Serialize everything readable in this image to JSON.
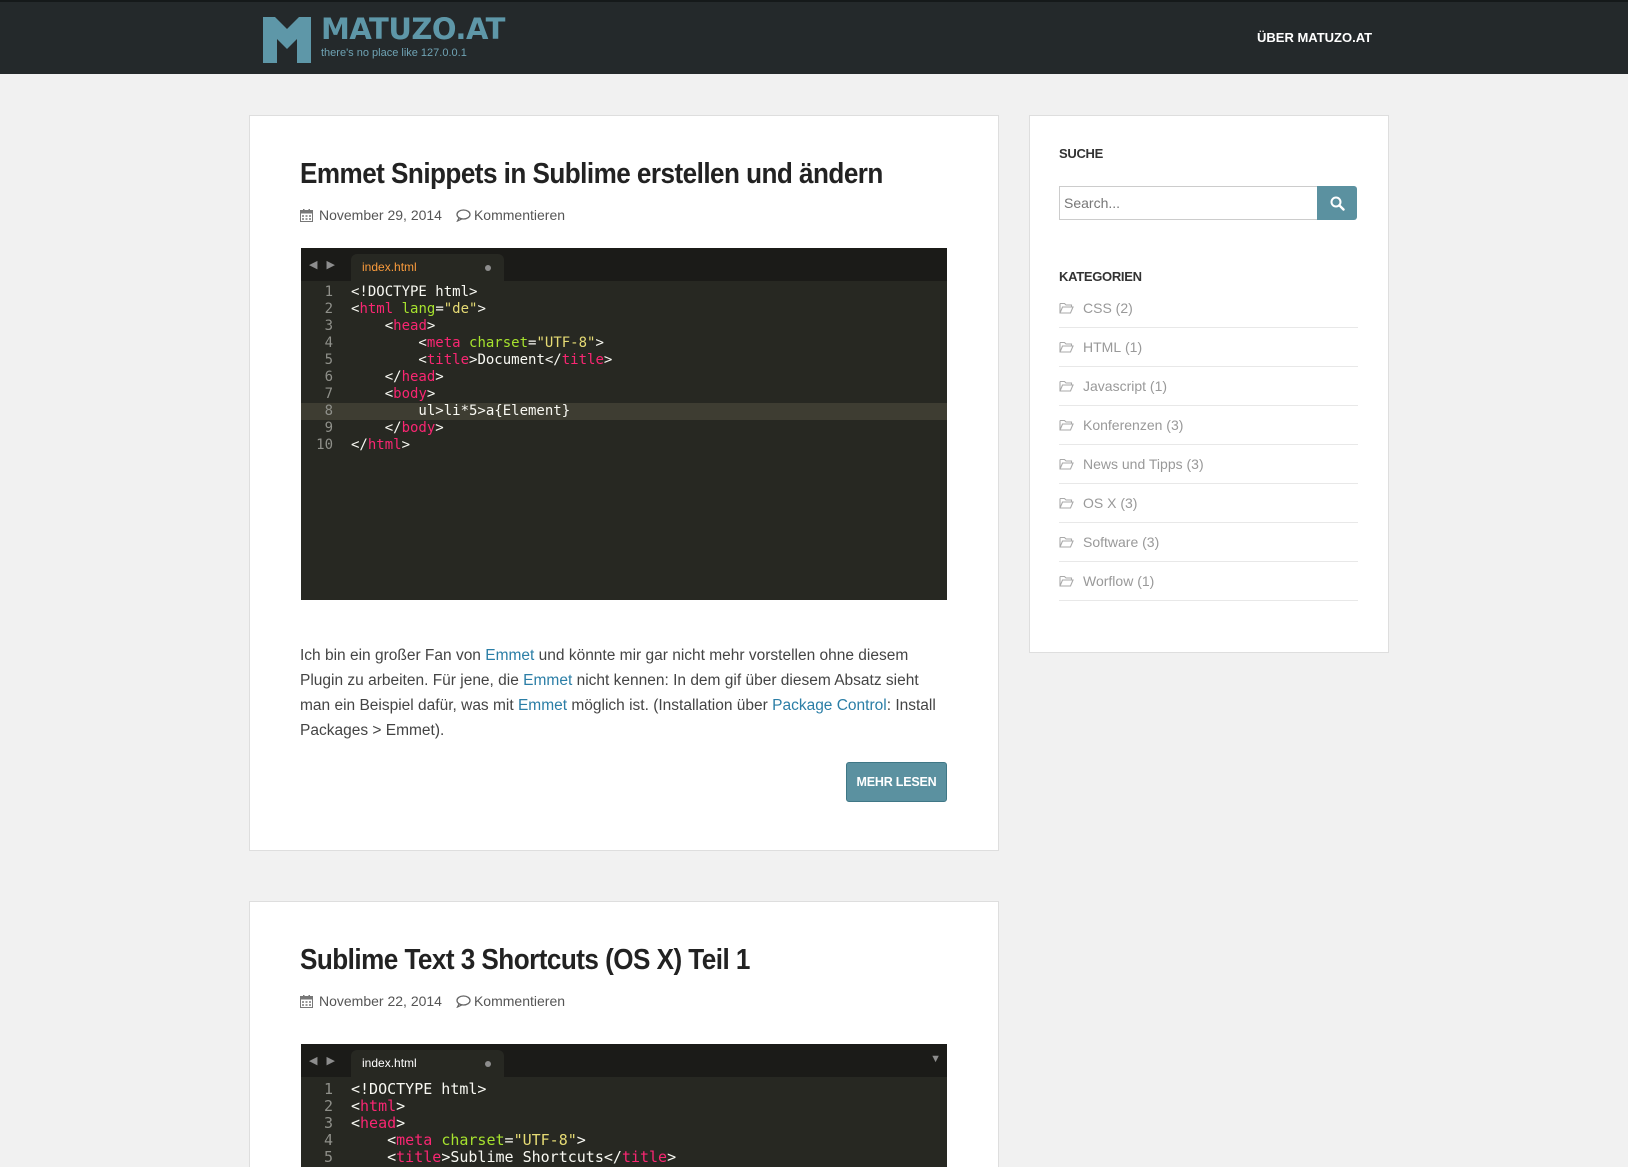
{
  "header": {
    "site_title": "MATUZO.AT",
    "tagline": "there's no place like 127.0.0.1",
    "nav": [
      "ÜBER MATUZO.AT"
    ],
    "brand_color": "#5e97a8"
  },
  "posts": [
    {
      "title": "Emmet Snippets in Sublime erstellen und ändern",
      "date": "November 29, 2014",
      "comments_label": "Kommentieren",
      "editor": {
        "tab_name": "index.html",
        "tab_color": "#f99b3c",
        "lines": [
          [
            {
              "t": "<!DOCTYPE html>",
              "c": ""
            }
          ],
          [
            {
              "t": "<",
              "c": ""
            },
            {
              "t": "html",
              "c": "t-tag"
            },
            {
              "t": " ",
              "c": ""
            },
            {
              "t": "lang",
              "c": "t-attr"
            },
            {
              "t": "=",
              "c": ""
            },
            {
              "t": "\"de\"",
              "c": "t-str"
            },
            {
              "t": ">",
              "c": ""
            }
          ],
          [
            {
              "t": "    <",
              "c": ""
            },
            {
              "t": "head",
              "c": "t-tag"
            },
            {
              "t": ">",
              "c": ""
            }
          ],
          [
            {
              "t": "        <",
              "c": ""
            },
            {
              "t": "meta",
              "c": "t-tag"
            },
            {
              "t": " ",
              "c": ""
            },
            {
              "t": "charset",
              "c": "t-attr"
            },
            {
              "t": "=",
              "c": ""
            },
            {
              "t": "\"UTF-8\"",
              "c": "t-str"
            },
            {
              "t": ">",
              "c": ""
            }
          ],
          [
            {
              "t": "        <",
              "c": ""
            },
            {
              "t": "title",
              "c": "t-tag"
            },
            {
              "t": ">Document</",
              "c": ""
            },
            {
              "t": "title",
              "c": "t-tag"
            },
            {
              "t": ">",
              "c": ""
            }
          ],
          [
            {
              "t": "    </",
              "c": ""
            },
            {
              "t": "head",
              "c": "t-tag"
            },
            {
              "t": ">",
              "c": ""
            }
          ],
          [
            {
              "t": "    <",
              "c": ""
            },
            {
              "t": "body",
              "c": "t-tag"
            },
            {
              "t": ">",
              "c": ""
            }
          ],
          [
            {
              "t": "        ul>li*5>a{Element}",
              "c": ""
            }
          ],
          [
            {
              "t": "    </",
              "c": ""
            },
            {
              "t": "body",
              "c": "t-tag"
            },
            {
              "t": ">",
              "c": ""
            }
          ],
          [
            {
              "t": "</",
              "c": ""
            },
            {
              "t": "html",
              "c": "t-tag"
            },
            {
              "t": ">",
              "c": ""
            }
          ]
        ],
        "active_line": 8
      },
      "excerpt": [
        {
          "t": "Ich bin ein großer Fan von ",
          "link": false
        },
        {
          "t": "Emmet",
          "link": true
        },
        {
          "t": " und könnte mir gar nicht mehr vorstellen ohne diesem Plugin zu arbeiten. Für jene, die ",
          "link": false
        },
        {
          "t": "Emmet",
          "link": true
        },
        {
          "t": " nicht kennen: In dem gif über diesem Absatz sieht man ein Beispiel dafür, was mit ",
          "link": false
        },
        {
          "t": "Emmet",
          "link": true
        },
        {
          "t": " möglich ist. (Installation über ",
          "link": false
        },
        {
          "t": "Package Control",
          "link": true
        },
        {
          "t": ": Install Packages > Emmet).",
          "link": false
        }
      ],
      "read_more": "MEHR LESEN"
    },
    {
      "title": "Sublime Text 3 Shortcuts (OS X) Teil 1",
      "date": "November 22, 2014",
      "comments_label": "Kommentieren",
      "editor": {
        "tab_name": "index.html",
        "tab_color": "#ffffff",
        "lines": [
          [
            {
              "t": "<!DOCTYPE html>",
              "c": ""
            }
          ],
          [
            {
              "t": "<",
              "c": ""
            },
            {
              "t": "html",
              "c": "t-tag"
            },
            {
              "t": ">",
              "c": ""
            }
          ],
          [
            {
              "t": "<",
              "c": ""
            },
            {
              "t": "head",
              "c": "t-tag"
            },
            {
              "t": ">",
              "c": ""
            }
          ],
          [
            {
              "t": "    <",
              "c": ""
            },
            {
              "t": "meta",
              "c": "t-tag"
            },
            {
              "t": " ",
              "c": ""
            },
            {
              "t": "charset",
              "c": "t-attr"
            },
            {
              "t": "=",
              "c": ""
            },
            {
              "t": "\"UTF-8\"",
              "c": "t-str"
            },
            {
              "t": ">",
              "c": ""
            }
          ],
          [
            {
              "t": "    <",
              "c": ""
            },
            {
              "t": "title",
              "c": "t-tag"
            },
            {
              "t": ">Sublime Shortcuts</",
              "c": ""
            },
            {
              "t": "title",
              "c": "t-tag"
            },
            {
              "t": ">",
              "c": ""
            }
          ]
        ],
        "active_line": 0
      }
    }
  ],
  "sidebar": {
    "search_title": "SUCHE",
    "search_placeholder": "Search...",
    "categories_title": "KATEGORIEN",
    "categories": [
      {
        "name": "CSS",
        "count": "(2)"
      },
      {
        "name": "HTML",
        "count": "(1)"
      },
      {
        "name": "Javascript",
        "count": "(1)"
      },
      {
        "name": "Konferenzen",
        "count": "(3)"
      },
      {
        "name": "News und Tipps",
        "count": "(3)"
      },
      {
        "name": "OS X",
        "count": "(3)"
      },
      {
        "name": "Software",
        "count": "(3)"
      },
      {
        "name": "Worflow",
        "count": "(1)"
      }
    ]
  }
}
